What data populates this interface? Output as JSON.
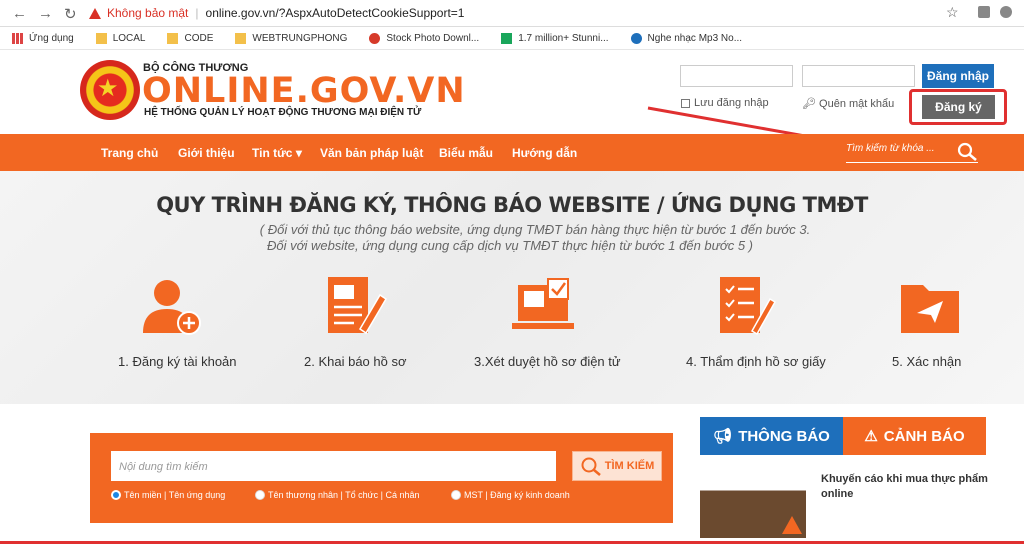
{
  "browser": {
    "insecure_label": "Không bảo mật",
    "url": "online.gov.vn/?AspxAutoDetectCookieSupport=1"
  },
  "bookmarks": [
    {
      "label": "Ứng dụng",
      "icon": "apps-grid-icon"
    },
    {
      "label": "LOCAL",
      "icon": "folder-icon"
    },
    {
      "label": "CODE",
      "icon": "folder-icon"
    },
    {
      "label": "WEBTRUNGPHONG",
      "icon": "folder-icon"
    },
    {
      "label": "Stock Photo Downl...",
      "icon": "tomato-favicon-icon"
    },
    {
      "label": "1.7 million+ Stunni...",
      "icon": "px-favicon-icon"
    },
    {
      "label": "Nghe nhạc Mp3 No...",
      "icon": "music-favicon-icon"
    }
  ],
  "header": {
    "ministry": "BỘ CÔNG THƯƠNG",
    "site": "ONLINE.GOV.VN",
    "subtitle": "HỆ THỐNG QUẢN LÝ HOẠT ĐỘNG THƯƠNG MẠI ĐIỆN TỬ",
    "login_button": "Đăng nhập",
    "remember_label": "Lưu đăng nhập",
    "forgot_label": "Quên mật khẩu",
    "register_button": "Đăng ký"
  },
  "nav": {
    "items": [
      "Trang chủ",
      "Giới thiệu",
      "Tin tức",
      "Văn bản pháp luật",
      "Biểu mẫu",
      "Hướng dẫn"
    ],
    "search_placeholder": "Tìm kiếm từ khóa ..."
  },
  "hero": {
    "title": "QUY TRÌNH ĐĂNG KÝ, THÔNG BÁO WEBSITE / ỨNG DỤNG TMĐT",
    "note_line1": "( Đối với thủ tục thông báo website, ứng dụng TMĐT bán hàng thực hiện từ bước 1 đến bước 3.",
    "note_line2": "Đối với website, ứng dụng cung cấp dịch vụ TMĐT thực hiện từ bước 1 đến bước 5 )",
    "steps": [
      {
        "label": "1. Đăng ký tài khoản",
        "icon": "user-add-icon"
      },
      {
        "label": "2. Khai báo hồ sơ",
        "icon": "document-edit-icon"
      },
      {
        "label": "3.Xét duyệt hồ sơ điện tử",
        "icon": "laptop-check-icon"
      },
      {
        "label": "4. Thẩm định hồ sơ giấy",
        "icon": "checklist-icon"
      },
      {
        "label": "5. Xác nhận",
        "icon": "folder-send-icon"
      }
    ]
  },
  "search": {
    "placeholder": "Nội dung tìm kiếm",
    "button": "TÌM KIẾM",
    "options": [
      "Tên miền | Tên ứng dụng",
      "Tên thương nhân | Tổ chức | Cá nhân",
      "MST | Đăng ký kinh doanh"
    ],
    "selected": 0
  },
  "news": {
    "tab_notice": "THÔNG BÁO",
    "tab_warning": "CẢNH BÁO",
    "item_title": "Khuyến cáo khi mua thực phẩm online"
  },
  "colors": {
    "brand_orange": "#f26722",
    "brand_blue": "#1e6fbb",
    "annotation_red": "#e03030"
  }
}
